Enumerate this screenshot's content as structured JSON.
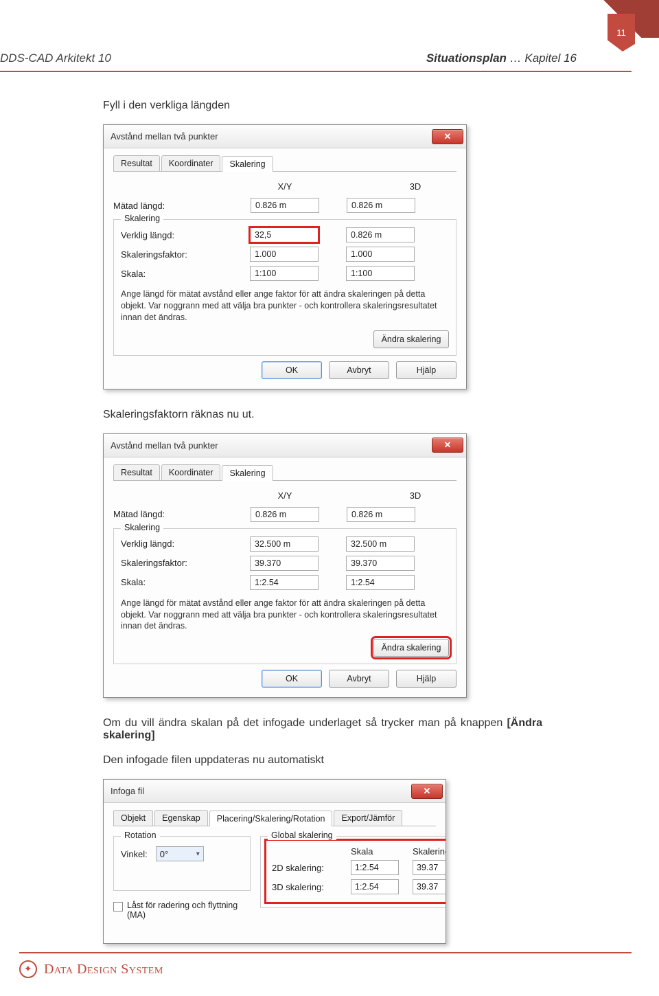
{
  "page": {
    "number": "11"
  },
  "header": {
    "left": "DDS-CAD Arkitekt 10",
    "right_bold": "Situationsplan",
    "right_thin": " … Kapitel 16"
  },
  "body": {
    "intro1": "Fyll i den verkliga längden",
    "intro2": "Skaleringsfaktorn räknas nu ut.",
    "intro3a": "Om du vill ändra skalan på det infogade underlaget så trycker man på knappen ",
    "intro3b": "[Ändra skalering]",
    "intro4": "Den infogade filen uppdateras nu automatiskt"
  },
  "dialog1": {
    "title": "Avstånd mellan två punkter",
    "tabs": [
      "Resultat",
      "Koordinater",
      "Skalering"
    ],
    "col_xy": "X/Y",
    "col_3d": "3D",
    "measured_label": "Mätad längd:",
    "measured_xy": "0.826 m",
    "measured_3d": "0.826 m",
    "fs_legend": "Skalering",
    "real_label": "Verklig längd:",
    "real_xy": "32,5",
    "real_3d": "0.826 m",
    "factor_label": "Skaleringsfaktor:",
    "factor_xy": "1.000",
    "factor_3d": "1.000",
    "scale_label": "Skala:",
    "scale_xy": "1:100",
    "scale_3d": "1:100",
    "note": "Ange längd för mätat avstånd eller ange faktor för att ändra skaleringen på detta objekt. Var noggrann med att välja  bra punkter - och kontrollera skaleringsresultatet innan det ändras.",
    "btn_change": "Ändra skalering",
    "btn_ok": "OK",
    "btn_cancel": "Avbryt",
    "btn_help": "Hjälp"
  },
  "dialog2": {
    "title": "Avstånd mellan två punkter",
    "tabs": [
      "Resultat",
      "Koordinater",
      "Skalering"
    ],
    "col_xy": "X/Y",
    "col_3d": "3D",
    "measured_label": "Mätad längd:",
    "measured_xy": "0.826 m",
    "measured_3d": "0.826 m",
    "fs_legend": "Skalering",
    "real_label": "Verklig längd:",
    "real_xy": "32.500 m",
    "real_3d": "32.500 m",
    "factor_label": "Skaleringsfaktor:",
    "factor_xy": "39.370",
    "factor_3d": "39.370",
    "scale_label": "Skala:",
    "scale_xy": "1:2.54",
    "scale_3d": "1:2.54",
    "note": "Ange längd för mätat avstånd eller ange faktor för att ändra skaleringen på detta objekt. Var noggrann med att välja  bra punkter - och kontrollera skaleringsresultatet innan det ändras.",
    "btn_change": "Ändra skalering",
    "btn_ok": "OK",
    "btn_cancel": "Avbryt",
    "btn_help": "Hjälp"
  },
  "dialog3": {
    "title": "Infoga fil",
    "tabs": [
      "Objekt",
      "Egenskap",
      "Placering/Skalering/Rotation",
      "Export/Jämför"
    ],
    "fs_rotation": "Rotation",
    "angle_label": "Vinkel:",
    "angle_value": "0°",
    "lock_label": "Låst för radering och flyttning (MA)",
    "fs_global": "Global skalering",
    "col_scale": "Skala",
    "col_scaling": "Skalering",
    "row_2d": "2D skalering:",
    "row_3d": "3D skalering:",
    "val_2d_scale": "1:2.54",
    "val_2d_scaling": "39.37",
    "val_3d_scale": "1:2.54",
    "val_3d_scaling": "39.37"
  },
  "footer": {
    "brand": "Data Design System"
  }
}
